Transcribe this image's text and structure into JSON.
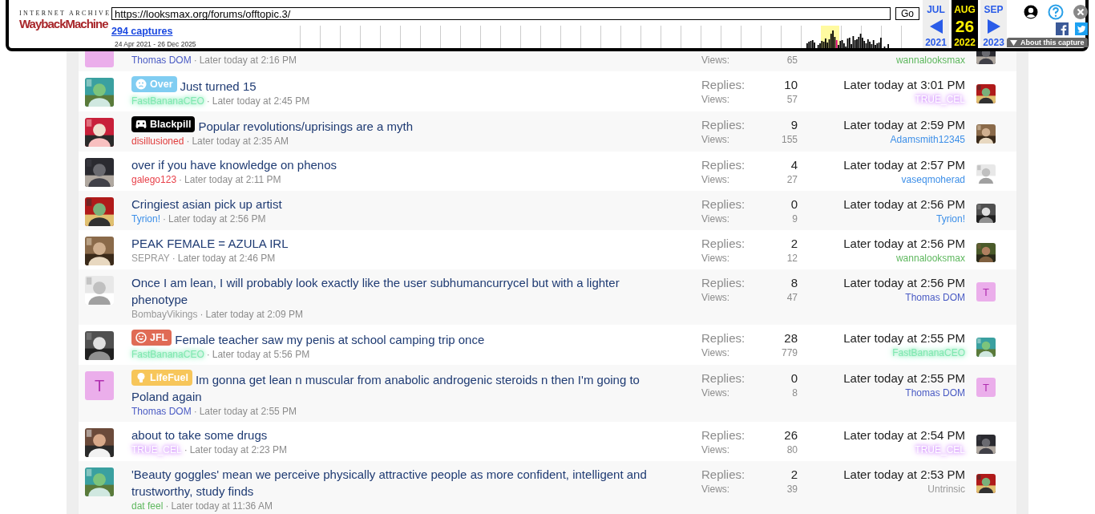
{
  "wayback": {
    "brand_top": "INTERNET ARCHIVE",
    "brand_main": "WaybackMachine",
    "url": "https://looksmax.org/forums/offtopic.3/",
    "go": "Go",
    "captures": "294 captures",
    "range": "24 Apr 2021 - 26 Dec 2025",
    "months": [
      {
        "month": "JUL",
        "year": "2021",
        "selected": false,
        "kind": "prev"
      },
      {
        "month": "AUG",
        "day": "26",
        "year": "2022",
        "selected": true,
        "kind": "current"
      },
      {
        "month": "SEP",
        "year": "2023",
        "selected": false,
        "kind": "next"
      }
    ],
    "about": "About this capture"
  },
  "threads": [
    {
      "avatar": {
        "kind": "letter"
      },
      "author": {
        "name": "Thomas DOM",
        "color": "#4a5bc4",
        "glow": false
      },
      "sep": "·",
      "time": "Later today at 2:16 PM",
      "views_label": "Views:",
      "views": "65",
      "last_user": {
        "name": "wannalooksmax",
        "color": "#5fb85f",
        "glow": false
      }
    },
    {
      "prefix": {
        "label": "Over",
        "kind": "sad",
        "color": "#80cdf2"
      },
      "title": "Just turned 15",
      "author": {
        "name": "FastBananaCEO",
        "color": "#7fe8b0",
        "glow": true
      },
      "sep": "·",
      "time": "Later today at 2:45 PM",
      "replies_label": "Replies:",
      "replies": "10",
      "views_label": "Views:",
      "views": "57",
      "last_time": "Later today at 3:01 PM",
      "last_user": {
        "name": "TRUE_CEL",
        "color": "#ffffff",
        "glow": true
      }
    },
    {
      "prefix": {
        "label": "Blackpill",
        "kind": "pill",
        "color": "#000000"
      },
      "title": "Popular revolutions/uprisings are a myth",
      "author": {
        "name": "disillusioned",
        "color": "#e03c3c",
        "glow": false
      },
      "sep": "·",
      "time": "Later today at 2:35 AM",
      "replies_label": "Replies:",
      "replies": "9",
      "views_label": "Views:",
      "views": "155",
      "last_time": "Later today at 2:59 PM",
      "last_user": {
        "name": "Adamsmith12345",
        "color": "#3d8fe8",
        "glow": false
      }
    },
    {
      "title": "over if you have knowledge on phenos",
      "author": {
        "name": "galego123",
        "color": "#e8414a",
        "glow": false
      },
      "sep": "·",
      "time": "Later today at 2:11 PM",
      "replies_label": "Replies:",
      "replies": "4",
      "views_label": "Views:",
      "views": "27",
      "last_time": "Later today at 2:57 PM",
      "last_user": {
        "name": "vaseqmoherad",
        "color": "#3d8fe8",
        "glow": false
      }
    },
    {
      "title": "Cringiest asian pick up artist",
      "author": {
        "name": "Tyrion!",
        "color": "#3d8fe8",
        "glow": false
      },
      "sep": "·",
      "time": "Later today at 2:56 PM",
      "replies_label": "Replies:",
      "replies": "0",
      "views_label": "Views:",
      "views": "9",
      "last_time": "Later today at 2:56 PM",
      "last_user": {
        "name": "Tyrion!",
        "color": "#3d8fe8",
        "glow": false
      }
    },
    {
      "title": "PEAK FEMALE = AZULA IRL",
      "author": {
        "name": "SEPRAY",
        "color": "#999999",
        "glow": false
      },
      "sep": "·",
      "time": "Later today at 2:46 PM",
      "replies_label": "Replies:",
      "replies": "2",
      "views_label": "Views:",
      "views": "12",
      "last_time": "Later today at 2:56 PM",
      "last_user": {
        "name": "wannalooksmax",
        "color": "#5fb85f",
        "glow": false
      }
    },
    {
      "title": "Once I am lean, I will probably look exactly like the user subhumancurrycel but with a lighter phenotype",
      "author": {
        "name": "BombayVikings",
        "color": "#999999",
        "glow": false
      },
      "sep": "·",
      "time": "Later today at 2:09 PM",
      "replies_label": "Replies:",
      "replies": "8",
      "views_label": "Views:",
      "views": "47",
      "last_time": "Later today at 2:56 PM",
      "last_user": {
        "name": "Thomas DOM",
        "color": "#4a5bc4",
        "glow": false
      },
      "last_avatar": {
        "kind": "letter",
        "letter": "T"
      }
    },
    {
      "prefix": {
        "label": "JFL",
        "kind": "laugh",
        "color": "#e06b55"
      },
      "title": "Female teacher saw my penis at school camping trip once",
      "author": {
        "name": "FastBananaCEO",
        "color": "#7fe8b0",
        "glow": true
      },
      "sep": "·",
      "time": "Later today at 5:56 PM",
      "replies_label": "Replies:",
      "replies": "28",
      "views_label": "Views:",
      "views": "779",
      "last_time": "Later today at 2:55 PM",
      "last_user": {
        "name": "FastBananaCEO",
        "color": "#7fe8b0",
        "glow": true
      }
    },
    {
      "avatar": {
        "kind": "letter",
        "letter": "T"
      },
      "prefix": {
        "label": "LifeFuel",
        "kind": "bulb",
        "color": "#f7c65a"
      },
      "title": "Im gonna get lean n muscular from anabolic androgenic steroids n then I'm going to Poland again",
      "author": {
        "name": "Thomas DOM",
        "color": "#4a5bc4",
        "glow": false
      },
      "sep": "·",
      "time": "Later today at 2:55 PM",
      "replies_label": "Replies:",
      "replies": "0",
      "views_label": "Views:",
      "views": "8",
      "last_time": "Later today at 2:55 PM",
      "last_user": {
        "name": "Thomas DOM",
        "color": "#4a5bc4",
        "glow": false
      },
      "last_avatar": {
        "kind": "letter",
        "letter": "T"
      }
    },
    {
      "title": "about to take some drugs",
      "author": {
        "name": "TRUE_CEL",
        "color": "#ffffff",
        "glow": true
      },
      "sep": "·",
      "time": "Later today at 2:23 PM",
      "replies_label": "Replies:",
      "replies": "26",
      "views_label": "Views:",
      "views": "80",
      "last_time": "Later today at 2:54 PM",
      "last_user": {
        "name": "TRUE_CEL",
        "color": "#ffffff",
        "glow": true
      }
    },
    {
      "title": "'Beauty goggles' mean we perceive physically attractive people as more confident, intelligent and trustworthy, study finds",
      "author": {
        "name": "dat feel",
        "color": "#5fb85f",
        "glow": false
      },
      "sep": "·",
      "time": "Later today at 11:36 AM",
      "replies_label": "Replies:",
      "replies": "2",
      "views_label": "Views:",
      "views": "39",
      "last_time": "Later today at 2:53 PM",
      "last_user": {
        "name": "Untrinsic",
        "color": "#999999",
        "glow": false
      }
    }
  ]
}
